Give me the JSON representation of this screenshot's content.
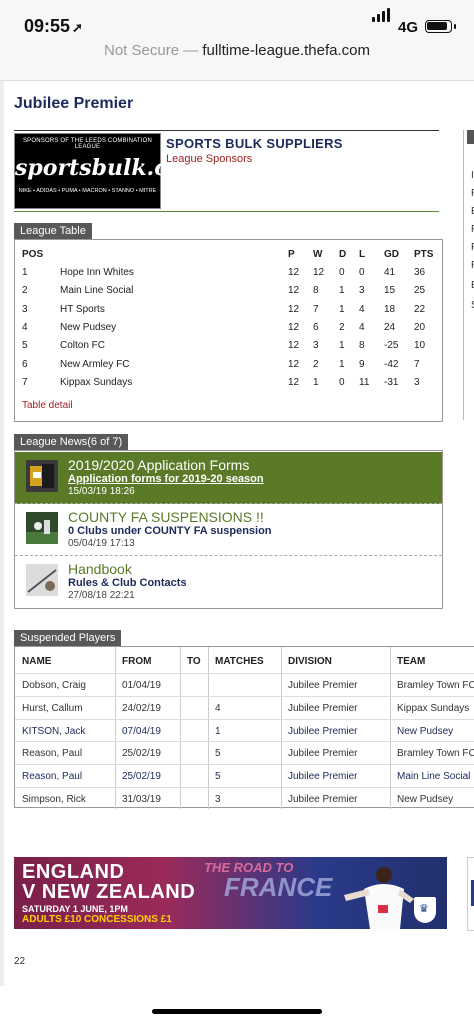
{
  "status_bar": {
    "time": "09:55",
    "network": "4G"
  },
  "browser": {
    "security": "Not Secure",
    "separator": "—",
    "domain": "fulltime-league.thefa.com"
  },
  "page": {
    "title": "Jubilee Premier",
    "page_number": "22"
  },
  "sponsor": {
    "logo_top": "SPONSORS OF THE LEEDS COMBINATION LEAGUE",
    "logo_text": "sportsbulk.co.uk",
    "logo_bottom": "NIKE • ADIDAS • PUMA • MACRON • STANNO • MITRE",
    "name": "SPORTS BULK SUPPLIERS",
    "role": "League Sponsors"
  },
  "league_table": {
    "label": "League Table",
    "headers": [
      "POS",
      "P",
      "W",
      "D",
      "L",
      "GD",
      "PTS"
    ],
    "rows": [
      {
        "pos": "1",
        "team": "Hope Inn Whites",
        "p": "12",
        "w": "12",
        "d": "0",
        "l": "0",
        "gd": "41",
        "pts": "36"
      },
      {
        "pos": "2",
        "team": "Main Line Social",
        "p": "12",
        "w": "8",
        "d": "1",
        "l": "3",
        "gd": "15",
        "pts": "25"
      },
      {
        "pos": "3",
        "team": "HT Sports",
        "p": "12",
        "w": "7",
        "d": "1",
        "l": "4",
        "gd": "18",
        "pts": "22"
      },
      {
        "pos": "4",
        "team": "New Pudsey",
        "p": "12",
        "w": "6",
        "d": "2",
        "l": "4",
        "gd": "24",
        "pts": "20"
      },
      {
        "pos": "5",
        "team": "Colton FC",
        "p": "12",
        "w": "3",
        "d": "1",
        "l": "8",
        "gd": "-25",
        "pts": "10"
      },
      {
        "pos": "6",
        "team": "New Armley FC",
        "p": "12",
        "w": "2",
        "d": "1",
        "l": "9",
        "gd": "-42",
        "pts": "7"
      },
      {
        "pos": "7",
        "team": "Kippax Sundays",
        "p": "12",
        "w": "1",
        "d": "0",
        "l": "11",
        "gd": "-31",
        "pts": "3"
      }
    ],
    "detail_link": "Table detail"
  },
  "league_news": {
    "label": "League News(6 of 7)",
    "items": [
      {
        "title": "2019/2020 Application Forms",
        "subtitle": "Application forms for 2019-20 season",
        "date": "15/03/19 18:26"
      },
      {
        "title": "COUNTY FA SUSPENSIONS !!",
        "subtitle": "0 Clubs under COUNTY FA suspension",
        "date": "05/04/19 17:13"
      },
      {
        "title": "Handbook",
        "subtitle": "Rules & Club Contacts",
        "date": "27/08/18 22:21"
      }
    ]
  },
  "suspended_players": {
    "label": "Suspended Players",
    "headers": [
      "NAME",
      "FROM",
      "TO",
      "MATCHES",
      "DIVISION",
      "TEAM"
    ],
    "rows": [
      {
        "name": "Dobson, Craig",
        "from": "01/04/19",
        "to": "",
        "matches": "",
        "division": "Jubilee Premier",
        "team": "Bramley Town FC"
      },
      {
        "name": "Hurst, Callum",
        "from": "24/02/19",
        "to": "",
        "matches": "4",
        "division": "Jubilee Premier",
        "team": "Kippax Sundays"
      },
      {
        "name": "KITSON, Jack",
        "from": "07/04/19",
        "to": "",
        "matches": "1",
        "division": "Jubilee Premier",
        "team": "New Pudsey"
      },
      {
        "name": "Reason, Paul",
        "from": "25/02/19",
        "to": "",
        "matches": "5",
        "division": "Jubilee Premier",
        "team": "Bramley Town FC"
      },
      {
        "name": "Reason, Paul",
        "from": "25/02/19",
        "to": "",
        "matches": "5",
        "division": "Jubilee Premier",
        "team": "Main Line Social"
      },
      {
        "name": "Simpson, Rick",
        "from": "31/03/19",
        "to": "",
        "matches": "3",
        "division": "Jubilee Premier",
        "team": "New Pudsey"
      }
    ]
  },
  "banner": {
    "line1": "ENGLAND",
    "line2": "V NEW ZEALAND",
    "line3": "SATURDAY 1 JUNE, 1PM",
    "line4": "ADULTS £10 CONCESSIONS £1",
    "road": "THE ROAD TO",
    "france": "FRANCE"
  },
  "colors": {
    "accent_green": "#5a7a28",
    "navy": "#1c2b5a",
    "link_red": "#a02020",
    "tab_grey": "#585858"
  }
}
